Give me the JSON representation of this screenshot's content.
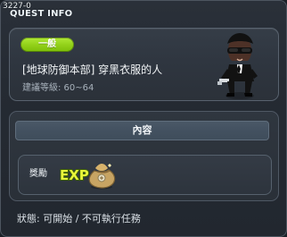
{
  "window": {
    "id": "3227-0",
    "title": "QUEST INFO"
  },
  "quest": {
    "category": "一般",
    "name": "[地球防御本部] 穿黑衣服的人",
    "recommended_level": "建議等級: 60~64",
    "npc_icon": "man-in-black-npc-icon",
    "category_color": "#93d11a"
  },
  "content": {
    "header": "內容",
    "reward_label": "獎勵",
    "reward_exp_text": "EXP",
    "reward_exp_icon": "exp-icon",
    "reward_bag_icon": "meso-bag-icon"
  },
  "status": {
    "text": "狀態: 可開始 / 不可執行任務"
  }
}
